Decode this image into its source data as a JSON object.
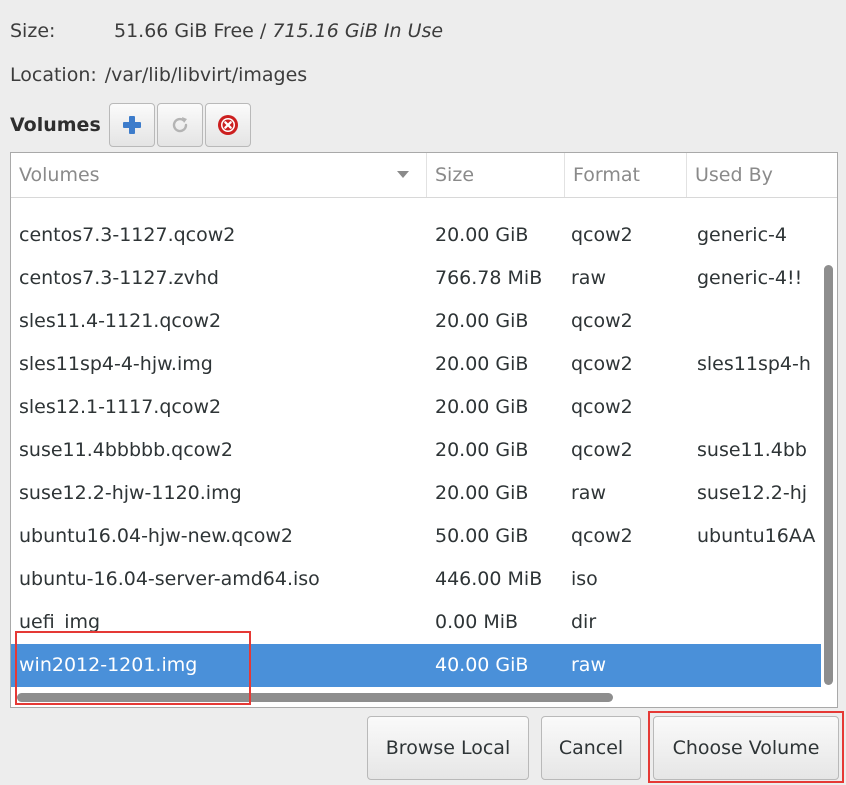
{
  "storage": {
    "size_label": "Size:",
    "free": "51.66 GiB Free",
    "separator": " / ",
    "in_use": "715.16 GiB In Use",
    "location_label": "Location:",
    "location": "/var/lib/libvirt/images"
  },
  "toolbar": {
    "title": "Volumes",
    "add_icon": "plus-icon",
    "refresh_icon": "refresh-icon",
    "delete_icon": "delete-icon",
    "add_color": "#3d7ccb",
    "delete_color": "#cc1f1f"
  },
  "table": {
    "headers": {
      "volumes": "Volumes",
      "size": "Size",
      "format": "Format",
      "used_by": "Used By"
    },
    "rows": [
      {
        "name": "centos7.3-1127.qcow2",
        "size": "20.00 GiB",
        "format": "qcow2",
        "used_by": "generic-4"
      },
      {
        "name": "centos7.3-1127.zvhd",
        "size": "766.78 MiB",
        "format": "raw",
        "used_by": "generic-4!!"
      },
      {
        "name": "sles11.4-1121.qcow2",
        "size": "20.00 GiB",
        "format": "qcow2",
        "used_by": ""
      },
      {
        "name": "sles11sp4-4-hjw.img",
        "size": "20.00 GiB",
        "format": "qcow2",
        "used_by": "sles11sp4-h"
      },
      {
        "name": "sles12.1-1117.qcow2",
        "size": "20.00 GiB",
        "format": "qcow2",
        "used_by": ""
      },
      {
        "name": "suse11.4bbbbb.qcow2",
        "size": "20.00 GiB",
        "format": "qcow2",
        "used_by": "suse11.4bb"
      },
      {
        "name": "suse12.2-hjw-1120.img",
        "size": "20.00 GiB",
        "format": "raw",
        "used_by": "suse12.2-hj"
      },
      {
        "name": "ubuntu16.04-hjw-new.qcow2",
        "size": "50.00 GiB",
        "format": "qcow2",
        "used_by": "ubuntu16AA"
      },
      {
        "name": "ubuntu-16.04-server-amd64.iso",
        "size": "446.00 MiB",
        "format": "iso",
        "used_by": ""
      },
      {
        "name": "uefi_img",
        "size": "0.00 MiB",
        "format": "dir",
        "used_by": ""
      },
      {
        "name": "win2012-1201.img",
        "size": "40.00 GiB",
        "format": "raw",
        "used_by": ""
      }
    ],
    "selected_index": 10,
    "selection_color": "#4a90d9"
  },
  "buttons": {
    "browse_local": "Browse Local",
    "cancel": "Cancel",
    "choose_volume": "Choose Volume"
  },
  "annotation_color": "#e53935"
}
